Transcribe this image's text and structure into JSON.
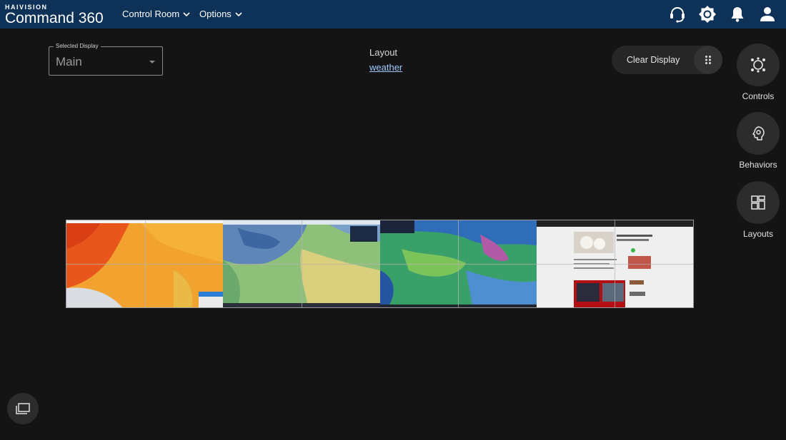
{
  "brand": {
    "company": "HAIVISION",
    "product": "Command 360"
  },
  "nav": {
    "control_room": "Control Room",
    "options": "Options"
  },
  "top_icons": [
    "headset-icon",
    "brightness-icon",
    "bell-icon",
    "user-icon"
  ],
  "selected_display": {
    "label": "Selected Display",
    "value": "Main"
  },
  "layout": {
    "title": "Layout",
    "name": "weather"
  },
  "actions": {
    "clear_display": "Clear Display"
  },
  "side_buttons": [
    {
      "label": "Controls",
      "icon": "controls-icon"
    },
    {
      "label": "Behaviors",
      "icon": "behaviors-icon"
    },
    {
      "label": "Layouts",
      "icon": "layouts-icon"
    }
  ],
  "wall": {
    "panels": [
      {
        "content": "temperature-map",
        "palette": [
          "#e85a1c",
          "#f08a2a",
          "#f3a82f",
          "#e9b341"
        ]
      },
      {
        "content": "forecast-map",
        "palette": [
          "#3d6fa6",
          "#5c9a6d",
          "#94c27a",
          "#c9d77f"
        ]
      },
      {
        "content": "radar-map",
        "palette": [
          "#2c64b4",
          "#36a06c",
          "#7dc45b",
          "#b35aa6"
        ]
      },
      {
        "content": "news-page",
        "palette": [
          "#f2f2f2",
          "#d8d8d8",
          "#b40f12",
          "#333333"
        ]
      }
    ]
  },
  "colors": {
    "topbar": "#0d3157",
    "background": "#141414",
    "link": "#9ec9ff"
  }
}
